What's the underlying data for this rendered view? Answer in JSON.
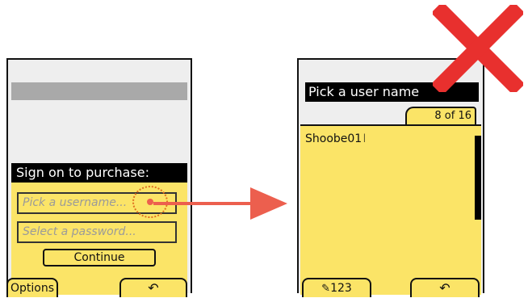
{
  "left_screen": {
    "dialog_title": "Sign on to purchase:",
    "username_placeholder": "Pick a username...",
    "password_placeholder": "Select a password...",
    "continue_label": "Continue",
    "options_label": "Options",
    "back_symbol": "↶"
  },
  "right_screen": {
    "title": "Pick a user name",
    "counter": "8 of 16",
    "entered_text": "Shoobe01",
    "cursor_symbol": "I",
    "input_mode_label": "123",
    "back_symbol": "↶"
  },
  "colors": {
    "screen_yellow": "#fbe467",
    "arrow": "#ec5f4e",
    "reject_mark": "#e8302e",
    "highlight_ring": "#e07020"
  }
}
